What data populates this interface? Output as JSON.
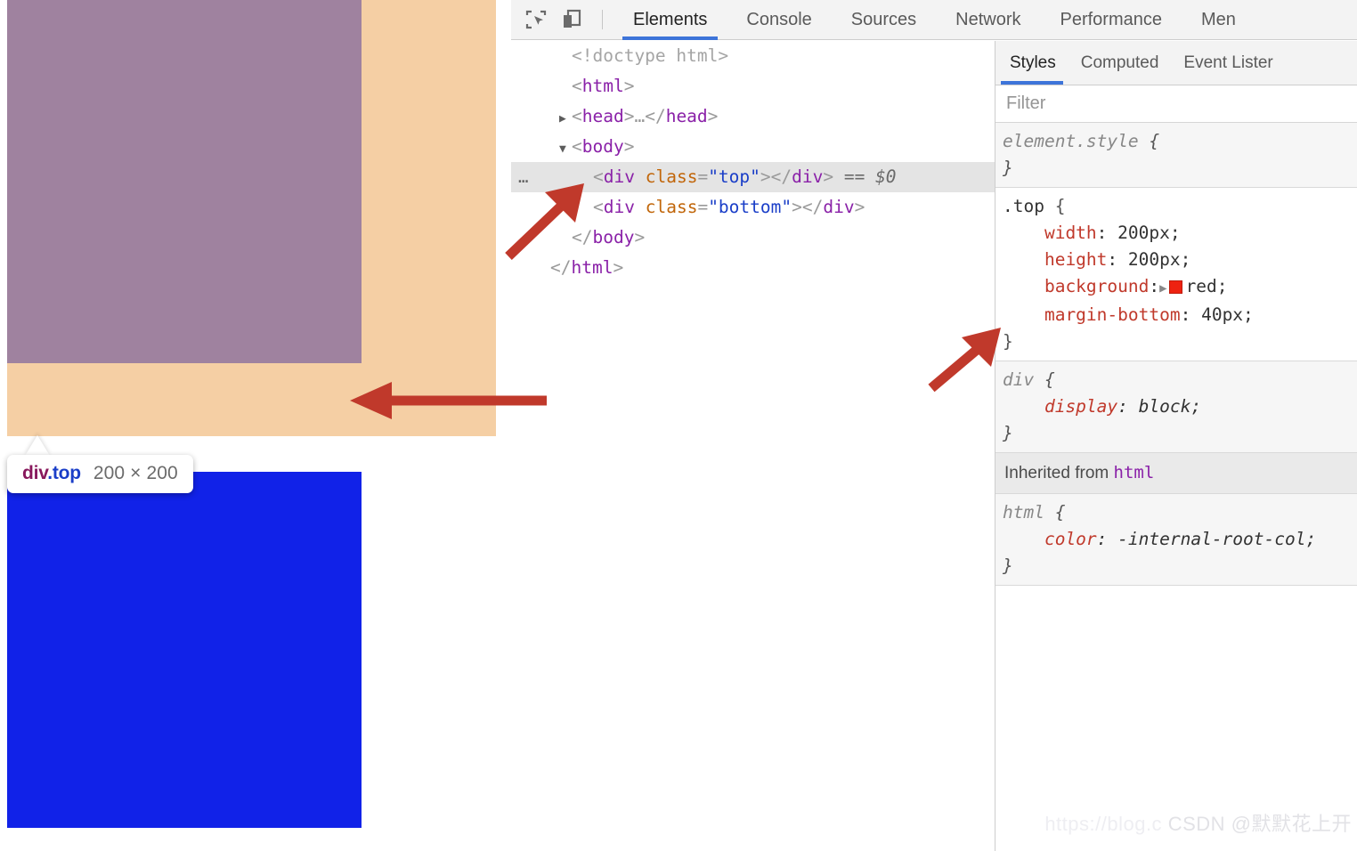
{
  "viewport": {
    "highlight": {
      "content_color": "#9f829f",
      "margin_color": "#f5cfa4",
      "element_tag": "div",
      "element_class": ".top",
      "dimensions": "200 × 200"
    },
    "bottom_box": {
      "color": "#1122e8",
      "class": "bottom"
    }
  },
  "devtools": {
    "toolbar": {
      "inspect_icon": "inspect-element-icon",
      "device_icon": "device-toolbar-icon",
      "tabs": [
        {
          "label": "Elements",
          "active": true
        },
        {
          "label": "Console",
          "active": false
        },
        {
          "label": "Sources",
          "active": false
        },
        {
          "label": "Network",
          "active": false
        },
        {
          "label": "Performance",
          "active": false
        },
        {
          "label": "Men",
          "active": false
        }
      ]
    },
    "dom_tree": [
      {
        "indent": 1,
        "twisty": "",
        "badge": "",
        "selected": false,
        "parts": [
          {
            "t": "doctype",
            "s": "<!doctype html>"
          }
        ]
      },
      {
        "indent": 1,
        "twisty": "",
        "badge": "",
        "selected": false,
        "parts": [
          {
            "t": "tw",
            "s": "<"
          },
          {
            "t": "tag-name",
            "s": "html"
          },
          {
            "t": "tw",
            "s": ">"
          }
        ]
      },
      {
        "indent": 1,
        "twisty": "▶",
        "badge": "",
        "selected": false,
        "parts": [
          {
            "t": "tw",
            "s": "<"
          },
          {
            "t": "tag-name",
            "s": "head"
          },
          {
            "t": "tw",
            "s": ">"
          },
          {
            "t": "comment",
            "s": "…"
          },
          {
            "t": "tw",
            "s": "</"
          },
          {
            "t": "tag-name",
            "s": "head"
          },
          {
            "t": "tw",
            "s": ">"
          }
        ]
      },
      {
        "indent": 1,
        "twisty": "▼",
        "badge": "",
        "selected": false,
        "parts": [
          {
            "t": "tw",
            "s": "<"
          },
          {
            "t": "tag-name",
            "s": "body"
          },
          {
            "t": "tw",
            "s": ">"
          }
        ]
      },
      {
        "indent": 2,
        "twisty": "",
        "badge": "…",
        "selected": true,
        "parts": [
          {
            "t": "tw",
            "s": "<"
          },
          {
            "t": "tag-name",
            "s": "div"
          },
          {
            "t": "tw",
            "s": " "
          },
          {
            "t": "attr-name",
            "s": "class"
          },
          {
            "t": "tw",
            "s": "="
          },
          {
            "t": "attr-val",
            "s": "\"top\""
          },
          {
            "t": "tw",
            "s": ">"
          },
          {
            "t": "tw",
            "s": "</"
          },
          {
            "t": "tag-name",
            "s": "div"
          },
          {
            "t": "tw",
            "s": ">"
          },
          {
            "t": "dollar",
            "s": " == $0"
          }
        ]
      },
      {
        "indent": 2,
        "twisty": "",
        "badge": "",
        "selected": false,
        "parts": [
          {
            "t": "tw",
            "s": "<"
          },
          {
            "t": "tag-name",
            "s": "div"
          },
          {
            "t": "tw",
            "s": " "
          },
          {
            "t": "attr-name",
            "s": "class"
          },
          {
            "t": "tw",
            "s": "="
          },
          {
            "t": "attr-val",
            "s": "\"bottom\""
          },
          {
            "t": "tw",
            "s": ">"
          },
          {
            "t": "tw",
            "s": "</"
          },
          {
            "t": "tag-name",
            "s": "div"
          },
          {
            "t": "tw",
            "s": ">"
          }
        ]
      },
      {
        "indent": 1,
        "twisty": "",
        "badge": "",
        "selected": false,
        "parts": [
          {
            "t": "tw",
            "s": "</"
          },
          {
            "t": "tag-name",
            "s": "body"
          },
          {
            "t": "tw",
            "s": ">"
          }
        ]
      },
      {
        "indent": 0,
        "twisty": "",
        "badge": "",
        "selected": false,
        "parts": [
          {
            "t": "tw",
            "s": "</"
          },
          {
            "t": "tag-name",
            "s": "html"
          },
          {
            "t": "tw",
            "s": ">"
          }
        ]
      }
    ],
    "styles": {
      "tabs": [
        {
          "label": "Styles",
          "active": true
        },
        {
          "label": "Computed",
          "active": false
        },
        {
          "label": "Event Lister",
          "active": false
        }
      ],
      "filter_placeholder": "Filter",
      "filter_value": "",
      "rules": [
        {
          "kind": "rule",
          "greyed": true,
          "selector": "element.style",
          "declarations": []
        },
        {
          "kind": "rule",
          "greyed": false,
          "selector": ".top",
          "declarations": [
            {
              "property": "width",
              "value": "200px",
              "swatch": null
            },
            {
              "property": "height",
              "value": "200px",
              "swatch": null
            },
            {
              "property": "background",
              "value": "red",
              "swatch": "#ee2211"
            },
            {
              "property": "margin-bottom",
              "value": "40px",
              "swatch": null
            }
          ]
        },
        {
          "kind": "rule",
          "greyed": true,
          "selector": "div",
          "declarations": [
            {
              "property": "display",
              "value": "block",
              "swatch": null
            }
          ]
        },
        {
          "kind": "inherited-header",
          "text": "Inherited from ",
          "source": "html"
        },
        {
          "kind": "rule",
          "greyed": true,
          "selector": "html",
          "declarations": [
            {
              "property": "color",
              "value": "-internal-root-col",
              "swatch": null
            }
          ]
        }
      ]
    }
  },
  "watermark": {
    "url": "https://blog.c",
    "brand": "CSDN",
    "author": "@默默花上开"
  }
}
